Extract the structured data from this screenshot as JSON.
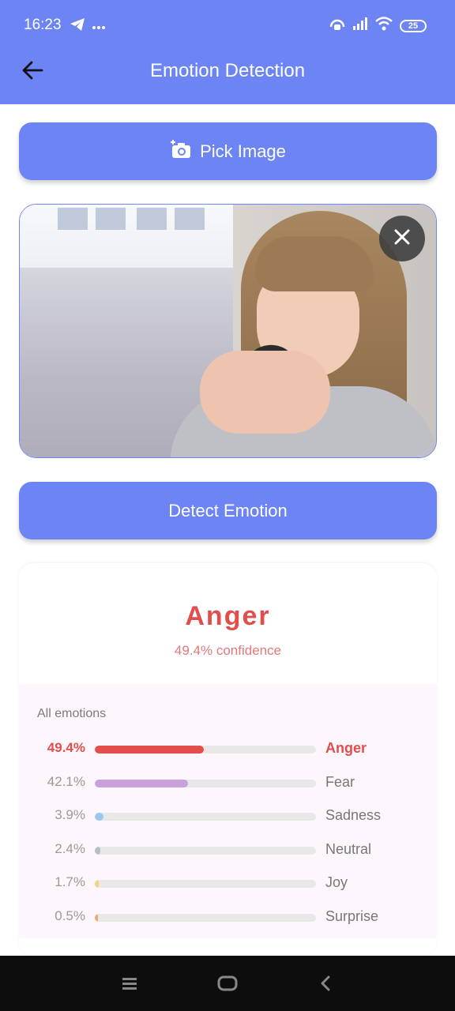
{
  "status_bar": {
    "time": "16:23",
    "battery": "25",
    "left_icons": [
      "telegram-icon",
      "more-dots-icon"
    ],
    "right_icons": [
      "hotspot-icon",
      "signal-icon",
      "wifi-icon",
      "battery-icon"
    ]
  },
  "app_bar": {
    "title": "Emotion Detection",
    "back_icon": "arrow-back-icon"
  },
  "pick_button": {
    "label": "Pick Image",
    "icon": "add-photo-icon"
  },
  "image": {
    "close_icon": "close-icon"
  },
  "detect_button": {
    "label": "Detect Emotion"
  },
  "result": {
    "top_emotion": "Anger",
    "confidence": "49.4% confidence",
    "all_title": "All emotions",
    "emotions": [
      {
        "pct_label": "49.4%",
        "value": 0.494,
        "label": "Anger",
        "color": "#e14e4c"
      },
      {
        "pct_label": "42.1%",
        "value": 0.421,
        "label": "Fear",
        "color": "#c9a0dc"
      },
      {
        "pct_label": "3.9%",
        "value": 0.039,
        "label": "Sadness",
        "color": "#9cc7ee"
      },
      {
        "pct_label": "2.4%",
        "value": 0.024,
        "label": "Neutral",
        "color": "#b7bfc6"
      },
      {
        "pct_label": "1.7%",
        "value": 0.017,
        "label": "Joy",
        "color": "#f3d37a"
      },
      {
        "pct_label": "0.5%",
        "value": 0.005,
        "label": "Surprise",
        "color": "#e6a97a"
      }
    ]
  },
  "colors": {
    "primary": "#6c84f4",
    "accent_red": "#e14e4c",
    "panel_bg": "#fdf6fc",
    "nav_bg": "#0d0d0d"
  },
  "nav_bar": {
    "icons": [
      "menu-icon",
      "home-icon",
      "back-icon"
    ]
  }
}
